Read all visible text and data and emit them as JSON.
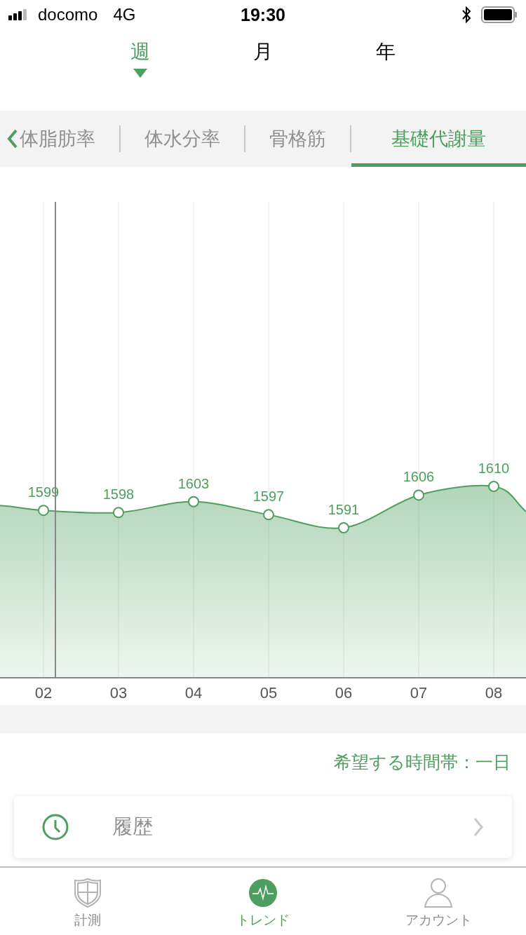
{
  "status_bar": {
    "carrier": "docomo",
    "network": "4G",
    "time": "19:30"
  },
  "period_tabs": [
    {
      "label": "週",
      "selected": true
    },
    {
      "label": "月",
      "selected": false
    },
    {
      "label": "年",
      "selected": false
    }
  ],
  "metric_tabs": [
    {
      "label": "体脂肪率",
      "selected": false
    },
    {
      "label": "体水分率",
      "selected": false
    },
    {
      "label": "骨格筋",
      "selected": false
    },
    {
      "label": "基礎代謝量",
      "selected": true
    }
  ],
  "chart_data": {
    "type": "area",
    "categories": [
      "02",
      "03",
      "04",
      "05",
      "06",
      "07",
      "08"
    ],
    "series": [
      {
        "color": "#4e9f5f",
        "values": [
          1599,
          1598,
          1603,
          1597,
          1591,
          1606,
          1610
        ]
      }
    ],
    "data_labels": true
  },
  "time_range": "希望する時間帯：一日",
  "history": {
    "label": "履歴"
  },
  "tab_bar": [
    {
      "label": "計測",
      "kind": "shield",
      "selected": false
    },
    {
      "label": "トレンド",
      "kind": "pulse",
      "selected": true
    },
    {
      "label": "アカウント",
      "kind": "person",
      "selected": false
    }
  ]
}
